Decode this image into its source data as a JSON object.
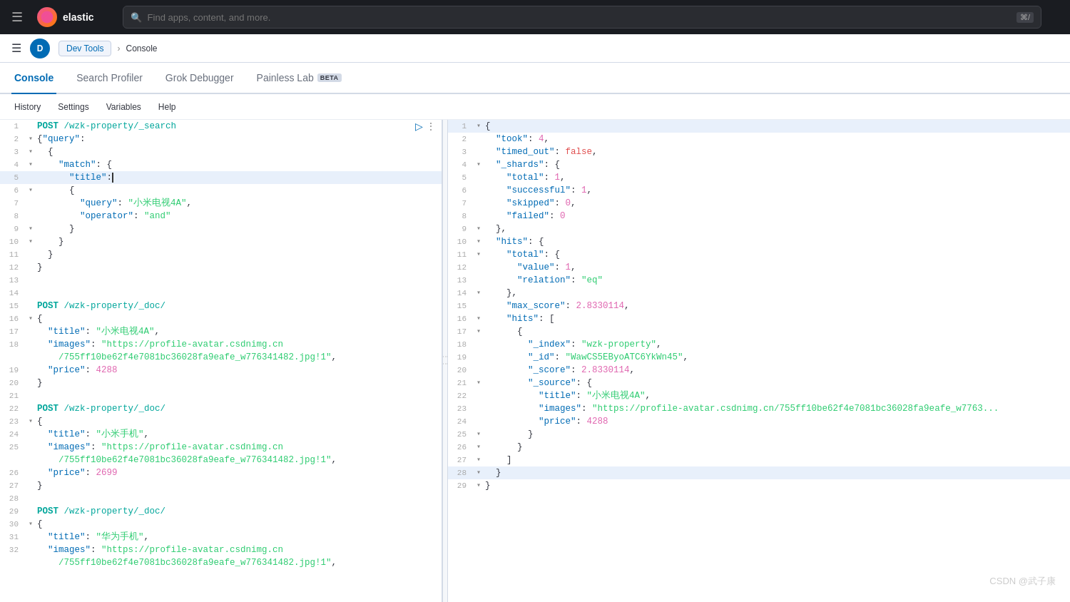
{
  "topbar": {
    "logo_text": "elastic",
    "search_placeholder": "Find apps, content, and more.",
    "kbd": "⌘/"
  },
  "breadcrumb": {
    "avatar_label": "D",
    "nav_link": "Dev Tools",
    "arrow": "›",
    "current": "Console"
  },
  "tabs": [
    {
      "id": "console",
      "label": "Console",
      "active": true,
      "beta": false
    },
    {
      "id": "search-profiler",
      "label": "Search Profiler",
      "active": false,
      "beta": false
    },
    {
      "id": "grok-debugger",
      "label": "Grok Debugger",
      "active": false,
      "beta": false
    },
    {
      "id": "painless-lab",
      "label": "Painless Lab",
      "active": false,
      "beta": true
    }
  ],
  "toolbar": {
    "history": "History",
    "settings": "Settings",
    "variables": "Variables",
    "help": "Help"
  },
  "editor": {
    "lines": [
      {
        "num": 1,
        "fold": "",
        "content": "POST /wzk-property/_search",
        "type": "method-path",
        "action": true
      },
      {
        "num": 2,
        "fold": "▾",
        "content": "{\"query\":",
        "type": "normal"
      },
      {
        "num": 3,
        "fold": "▾",
        "content": "  {",
        "type": "normal"
      },
      {
        "num": 4,
        "fold": "▾",
        "content": "    \"match\": {",
        "type": "normal"
      },
      {
        "num": 5,
        "fold": "",
        "content": "      \"title\":",
        "type": "normal",
        "highlight": true
      },
      {
        "num": 6,
        "fold": "▾",
        "content": "      {",
        "type": "normal"
      },
      {
        "num": 7,
        "fold": "",
        "content": "        \"query\": \"小米电视4A\",",
        "type": "normal"
      },
      {
        "num": 8,
        "fold": "",
        "content": "        \"operator\": \"and\"",
        "type": "normal"
      },
      {
        "num": 9,
        "fold": "▾",
        "content": "      }",
        "type": "normal"
      },
      {
        "num": 10,
        "fold": "▾",
        "content": "    }",
        "type": "normal"
      },
      {
        "num": 11,
        "fold": "",
        "content": "  }",
        "type": "normal"
      },
      {
        "num": 12,
        "fold": "",
        "content": "}",
        "type": "normal"
      },
      {
        "num": 13,
        "fold": "",
        "content": "",
        "type": "normal"
      },
      {
        "num": 14,
        "fold": "",
        "content": "",
        "type": "normal"
      },
      {
        "num": 15,
        "fold": "",
        "content": "POST /wzk-property/_doc/",
        "type": "method-path"
      },
      {
        "num": 16,
        "fold": "▾",
        "content": "{",
        "type": "normal"
      },
      {
        "num": 17,
        "fold": "",
        "content": "  \"title\": \"小米电视4A\",",
        "type": "normal"
      },
      {
        "num": 18,
        "fold": "",
        "content": "  \"images\": \"https://profile-avatar.csdnimg.cn",
        "type": "normal"
      },
      {
        "num": 18,
        "fold": "",
        "content": "    /755ff10be62f4e7081bc36028fa9eafe_w776341482.jpg!1\",",
        "type": "normal"
      },
      {
        "num": 19,
        "fold": "",
        "content": "  \"price\": 4288",
        "type": "normal"
      },
      {
        "num": 20,
        "fold": "",
        "content": "}",
        "type": "normal"
      },
      {
        "num": 21,
        "fold": "",
        "content": "",
        "type": "normal"
      },
      {
        "num": 22,
        "fold": "",
        "content": "POST /wzk-property/_doc/",
        "type": "method-path"
      },
      {
        "num": 23,
        "fold": "▾",
        "content": "{",
        "type": "normal"
      },
      {
        "num": 24,
        "fold": "",
        "content": "  \"title\": \"小米手机\",",
        "type": "normal"
      },
      {
        "num": 25,
        "fold": "",
        "content": "  \"images\": \"https://profile-avatar.csdnimg.cn",
        "type": "normal"
      },
      {
        "num": 25,
        "fold": "",
        "content": "    /755ff10be62f4e7081bc36028fa9eafe_w776341482.jpg!1\",",
        "type": "normal"
      },
      {
        "num": 26,
        "fold": "",
        "content": "  \"price\": 2699",
        "type": "normal"
      },
      {
        "num": 27,
        "fold": "",
        "content": "}",
        "type": "normal"
      },
      {
        "num": 28,
        "fold": "",
        "content": "",
        "type": "normal"
      },
      {
        "num": 29,
        "fold": "",
        "content": "POST /wzk-property/_doc/",
        "type": "method-path"
      },
      {
        "num": 30,
        "fold": "▾",
        "content": "{",
        "type": "normal"
      },
      {
        "num": 31,
        "fold": "",
        "content": "  \"title\": \"华为手机\",",
        "type": "normal"
      },
      {
        "num": 32,
        "fold": "",
        "content": "  \"images\": \"https://profile-avatar.csdnimg.cn",
        "type": "normal"
      },
      {
        "num": 32,
        "fold": "",
        "content": "    /755ff10be62f4e7081bc36028fa9eafe_w776341482.jpg!1\",",
        "type": "normal"
      }
    ]
  },
  "result": {
    "lines": [
      {
        "num": 1,
        "fold": "▾",
        "content": "{",
        "highlight": true
      },
      {
        "num": 2,
        "fold": "",
        "content": "  \"took\": 4,"
      },
      {
        "num": 3,
        "fold": "",
        "content": "  \"timed_out\": false,"
      },
      {
        "num": 4,
        "fold": "▾",
        "content": "  \"_shards\": {"
      },
      {
        "num": 5,
        "fold": "",
        "content": "    \"total\": 1,"
      },
      {
        "num": 6,
        "fold": "",
        "content": "    \"successful\": 1,"
      },
      {
        "num": 7,
        "fold": "",
        "content": "    \"skipped\": 0,"
      },
      {
        "num": 8,
        "fold": "",
        "content": "    \"failed\": 0"
      },
      {
        "num": 9,
        "fold": "▾",
        "content": "  },"
      },
      {
        "num": 10,
        "fold": "▾",
        "content": "  \"hits\": {"
      },
      {
        "num": 11,
        "fold": "▾",
        "content": "    \"total\": {"
      },
      {
        "num": 12,
        "fold": "",
        "content": "      \"value\": 1,"
      },
      {
        "num": 13,
        "fold": "",
        "content": "      \"relation\": \"eq\""
      },
      {
        "num": 14,
        "fold": "▾",
        "content": "    },"
      },
      {
        "num": 15,
        "fold": "",
        "content": "    \"max_score\": 2.8330114,"
      },
      {
        "num": 16,
        "fold": "▾",
        "content": "    \"hits\": ["
      },
      {
        "num": 17,
        "fold": "▾",
        "content": "      {"
      },
      {
        "num": 18,
        "fold": "",
        "content": "        \"_index\": \"wzk-property\","
      },
      {
        "num": 19,
        "fold": "",
        "content": "        \"_id\": \"WawCS5EByoATC6YkWn45\","
      },
      {
        "num": 20,
        "fold": "",
        "content": "        \"_score\": 2.8330114,"
      },
      {
        "num": 21,
        "fold": "▾",
        "content": "        \"_source\": {"
      },
      {
        "num": 22,
        "fold": "",
        "content": "          \"title\": \"小米电视4A\","
      },
      {
        "num": 23,
        "fold": "",
        "content": "          \"images\": \"https://profile-avatar.csdnimg.cn/755ff10be62f4e7081bc36028fa9eafe_w7763..."
      },
      {
        "num": 24,
        "fold": "",
        "content": "          \"price\": 4288"
      },
      {
        "num": 25,
        "fold": "▾",
        "content": "        }"
      },
      {
        "num": 26,
        "fold": "▾",
        "content": "      }"
      },
      {
        "num": 27,
        "fold": "▾",
        "content": "    ]"
      },
      {
        "num": 28,
        "fold": "▾",
        "content": "  }",
        "highlight": true
      },
      {
        "num": 29,
        "fold": "▾",
        "content": "}"
      }
    ]
  },
  "watermark": "CSDN @武子康"
}
